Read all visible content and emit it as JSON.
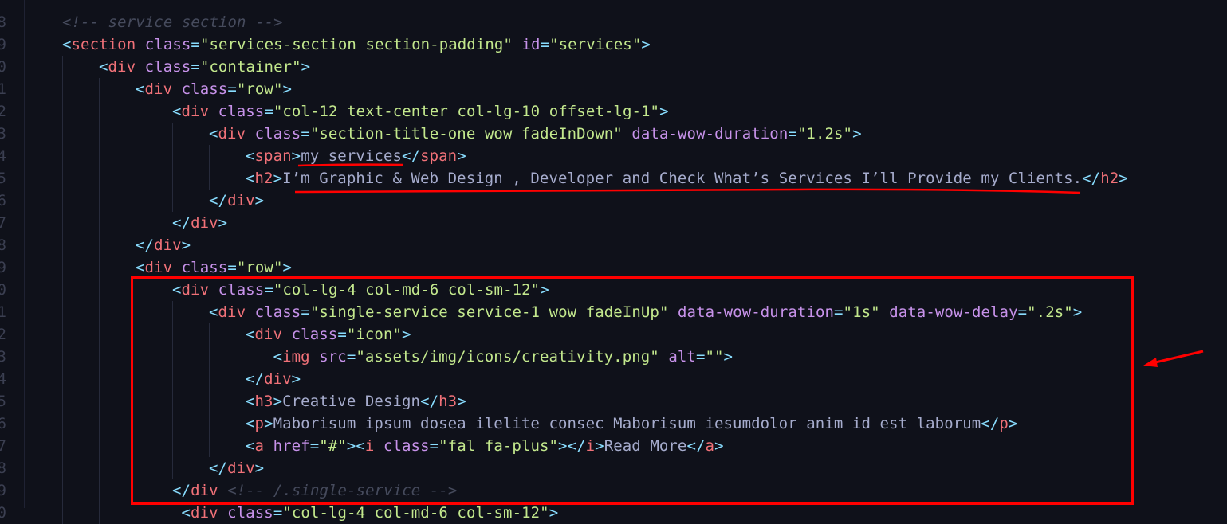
{
  "editor": {
    "theme_colors": {
      "background": "#0f111a",
      "bracket": "#89ddff",
      "tag": "#f07178",
      "attribute": "#c792ea",
      "string": "#c3e88d",
      "text": "#a6accd",
      "comment": "#464b5d",
      "annotation": "#ff0000"
    },
    "line_number_digits": [
      "8",
      "9",
      "0",
      "1",
      "2",
      "3",
      "4",
      "5",
      "6",
      "7",
      "8",
      "9",
      "0",
      "1",
      "2",
      "3",
      "4",
      "5",
      "6",
      "7",
      "8",
      "9",
      "0"
    ],
    "lines": [
      {
        "indent": 1,
        "pad": 0,
        "tokens": [
          [
            "com",
            "<!-- service section -->"
          ]
        ]
      },
      {
        "indent": 1,
        "pad": 0,
        "tokens": [
          [
            "br",
            "<"
          ],
          [
            "tag",
            "section"
          ],
          [
            "sp",
            " "
          ],
          [
            "attr",
            "class"
          ],
          [
            "eq",
            "="
          ],
          [
            "str",
            "\"services-section section-padding\""
          ],
          [
            "sp",
            " "
          ],
          [
            "attr",
            "id"
          ],
          [
            "eq",
            "="
          ],
          [
            "str",
            "\"services\""
          ],
          [
            "br",
            ">"
          ]
        ]
      },
      {
        "indent": 2,
        "pad": 0,
        "tokens": [
          [
            "br",
            "<"
          ],
          [
            "tag",
            "div"
          ],
          [
            "sp",
            " "
          ],
          [
            "attr",
            "class"
          ],
          [
            "eq",
            "="
          ],
          [
            "str",
            "\"container\""
          ],
          [
            "br",
            ">"
          ]
        ]
      },
      {
        "indent": 3,
        "pad": 0,
        "tokens": [
          [
            "br",
            "<"
          ],
          [
            "tag",
            "div"
          ],
          [
            "sp",
            " "
          ],
          [
            "attr",
            "class"
          ],
          [
            "eq",
            "="
          ],
          [
            "str",
            "\"row\""
          ],
          [
            "br",
            ">"
          ]
        ]
      },
      {
        "indent": 4,
        "pad": 0,
        "tokens": [
          [
            "br",
            "<"
          ],
          [
            "tag",
            "div"
          ],
          [
            "sp",
            " "
          ],
          [
            "attr",
            "class"
          ],
          [
            "eq",
            "="
          ],
          [
            "str",
            "\"col-12 text-center col-lg-10 offset-lg-1\""
          ],
          [
            "br",
            ">"
          ]
        ]
      },
      {
        "indent": 5,
        "pad": 0,
        "tokens": [
          [
            "br",
            "<"
          ],
          [
            "tag",
            "div"
          ],
          [
            "sp",
            " "
          ],
          [
            "attr",
            "class"
          ],
          [
            "eq",
            "="
          ],
          [
            "str",
            "\"section-title-one wow fadeInDown\""
          ],
          [
            "sp",
            " "
          ],
          [
            "attr",
            "data-wow-duration"
          ],
          [
            "eq",
            "="
          ],
          [
            "str",
            "\"1.2s\""
          ],
          [
            "br",
            ">"
          ]
        ]
      },
      {
        "indent": 6,
        "pad": 0,
        "tokens": [
          [
            "br",
            "<"
          ],
          [
            "tag",
            "span"
          ],
          [
            "br",
            ">"
          ],
          [
            "txt",
            "my services"
          ],
          [
            "br",
            "</"
          ],
          [
            "tag",
            "span"
          ],
          [
            "br",
            ">"
          ]
        ]
      },
      {
        "indent": 6,
        "pad": 0,
        "tokens": [
          [
            "br",
            "<"
          ],
          [
            "tag",
            "h2"
          ],
          [
            "br",
            ">"
          ],
          [
            "txt",
            "I’m Graphic & Web Design , Developer and Check What’s Services I’ll Provide my Clients."
          ],
          [
            "br",
            "</"
          ],
          [
            "tag",
            "h2"
          ],
          [
            "br",
            ">"
          ]
        ]
      },
      {
        "indent": 5,
        "pad": 0,
        "tokens": [
          [
            "br",
            "</"
          ],
          [
            "tag",
            "div"
          ],
          [
            "br",
            ">"
          ]
        ]
      },
      {
        "indent": 4,
        "pad": 0,
        "tokens": [
          [
            "br",
            "</"
          ],
          [
            "tag",
            "div"
          ],
          [
            "br",
            ">"
          ]
        ]
      },
      {
        "indent": 3,
        "pad": 0,
        "tokens": [
          [
            "br",
            "</"
          ],
          [
            "tag",
            "div"
          ],
          [
            "br",
            ">"
          ]
        ]
      },
      {
        "indent": 3,
        "pad": 0,
        "tokens": [
          [
            "br",
            "<"
          ],
          [
            "tag",
            "div"
          ],
          [
            "sp",
            " "
          ],
          [
            "attr",
            "class"
          ],
          [
            "eq",
            "="
          ],
          [
            "str",
            "\"row\""
          ],
          [
            "br",
            ">"
          ]
        ]
      },
      {
        "indent": 4,
        "pad": 0,
        "tokens": [
          [
            "br",
            "<"
          ],
          [
            "tag",
            "div"
          ],
          [
            "sp",
            " "
          ],
          [
            "attr",
            "class"
          ],
          [
            "eq",
            "="
          ],
          [
            "str",
            "\"col-lg-4 col-md-6 col-sm-12\""
          ],
          [
            "br",
            ">"
          ]
        ]
      },
      {
        "indent": 5,
        "pad": 0,
        "tokens": [
          [
            "br",
            "<"
          ],
          [
            "tag",
            "div"
          ],
          [
            "sp",
            " "
          ],
          [
            "attr",
            "class"
          ],
          [
            "eq",
            "="
          ],
          [
            "str",
            "\"single-service service-1 wow fadeInUp\""
          ],
          [
            "sp",
            " "
          ],
          [
            "attr",
            "data-wow-duration"
          ],
          [
            "eq",
            "="
          ],
          [
            "str",
            "\"1s\""
          ],
          [
            "sp",
            " "
          ],
          [
            "attr",
            "data-wow-delay"
          ],
          [
            "eq",
            "="
          ],
          [
            "str",
            "\".2s\""
          ],
          [
            "br",
            ">"
          ]
        ]
      },
      {
        "indent": 6,
        "pad": 0,
        "tokens": [
          [
            "br",
            "<"
          ],
          [
            "tag",
            "div"
          ],
          [
            "sp",
            " "
          ],
          [
            "attr",
            "class"
          ],
          [
            "eq",
            "="
          ],
          [
            "str",
            "\"icon\""
          ],
          [
            "br",
            ">"
          ]
        ]
      },
      {
        "indent": 6,
        "pad": 3,
        "tokens": [
          [
            "br",
            "<"
          ],
          [
            "tag",
            "img"
          ],
          [
            "sp",
            " "
          ],
          [
            "attr",
            "src"
          ],
          [
            "eq",
            "="
          ],
          [
            "str",
            "\"assets/img/icons/creativity.png\""
          ],
          [
            "sp",
            " "
          ],
          [
            "attr",
            "alt"
          ],
          [
            "eq",
            "="
          ],
          [
            "str",
            "\"\""
          ],
          [
            "br",
            ">"
          ]
        ]
      },
      {
        "indent": 6,
        "pad": 0,
        "tokens": [
          [
            "br",
            "</"
          ],
          [
            "tag",
            "div"
          ],
          [
            "br",
            ">"
          ]
        ]
      },
      {
        "indent": 6,
        "pad": 0,
        "tokens": [
          [
            "br",
            "<"
          ],
          [
            "tag",
            "h3"
          ],
          [
            "br",
            ">"
          ],
          [
            "txt",
            "Creative Design"
          ],
          [
            "br",
            "</"
          ],
          [
            "tag",
            "h3"
          ],
          [
            "br",
            ">"
          ]
        ]
      },
      {
        "indent": 6,
        "pad": 0,
        "tokens": [
          [
            "br",
            "<"
          ],
          [
            "tag",
            "p"
          ],
          [
            "br",
            ">"
          ],
          [
            "txt",
            "Maborisum ipsum dosea ilelite consec Maborisum iesumdolor anim id est laborum"
          ],
          [
            "br",
            "</"
          ],
          [
            "tag",
            "p"
          ],
          [
            "br",
            ">"
          ]
        ]
      },
      {
        "indent": 6,
        "pad": 0,
        "tokens": [
          [
            "br",
            "<"
          ],
          [
            "tag",
            "a"
          ],
          [
            "sp",
            " "
          ],
          [
            "attr",
            "href"
          ],
          [
            "eq",
            "="
          ],
          [
            "str",
            "\"#\""
          ],
          [
            "br",
            ">"
          ],
          [
            "br",
            "<"
          ],
          [
            "tag",
            "i"
          ],
          [
            "sp",
            " "
          ],
          [
            "attr",
            "class"
          ],
          [
            "eq",
            "="
          ],
          [
            "str",
            "\"fal fa-plus\""
          ],
          [
            "br",
            ">"
          ],
          [
            "br",
            "</"
          ],
          [
            "tag",
            "i"
          ],
          [
            "br",
            ">"
          ],
          [
            "txt",
            "Read More"
          ],
          [
            "br",
            "</"
          ],
          [
            "tag",
            "a"
          ],
          [
            "br",
            ">"
          ]
        ]
      },
      {
        "indent": 5,
        "pad": 0,
        "tokens": [
          [
            "br",
            "</"
          ],
          [
            "tag",
            "div"
          ],
          [
            "br",
            ">"
          ]
        ]
      },
      {
        "indent": 4,
        "pad": 0,
        "tokens": [
          [
            "br",
            "</"
          ],
          [
            "tag",
            "div"
          ],
          [
            "sp",
            " "
          ],
          [
            "com",
            "<!-- /.single-service -->"
          ]
        ]
      },
      {
        "indent": 4,
        "pad": 1,
        "tokens": [
          [
            "br",
            "<"
          ],
          [
            "tag",
            "div"
          ],
          [
            "sp",
            " "
          ],
          [
            "attr",
            "class"
          ],
          [
            "eq",
            "="
          ],
          [
            "str",
            "\"col-lg-4 col-md-6 col-sm-12\""
          ],
          [
            "br",
            ">"
          ]
        ]
      }
    ]
  },
  "annotations": [
    {
      "type": "underline",
      "target": "my services"
    },
    {
      "type": "underline",
      "target": "h2 text"
    },
    {
      "type": "box",
      "target": "single-service column block"
    },
    {
      "type": "arrow",
      "direction": "pointing-left-to-box"
    }
  ]
}
